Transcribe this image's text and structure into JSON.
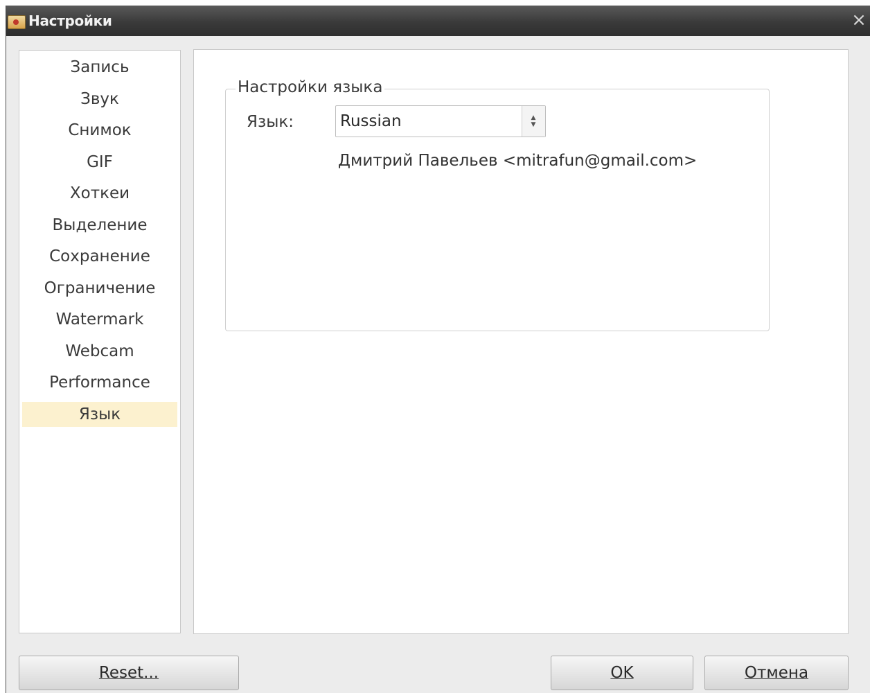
{
  "window": {
    "title": "Настройки",
    "close_glyph": "×"
  },
  "sidebar": {
    "items": [
      {
        "label": "Запись"
      },
      {
        "label": "Звук"
      },
      {
        "label": "Снимок"
      },
      {
        "label": "GIF"
      },
      {
        "label": "Хоткеи"
      },
      {
        "label": "Выделение"
      },
      {
        "label": "Сохранение"
      },
      {
        "label": "Ограничение"
      },
      {
        "label": "Watermark"
      },
      {
        "label": "Webcam"
      },
      {
        "label": "Performance"
      },
      {
        "label": "Язык",
        "selected": true
      }
    ]
  },
  "language_settings": {
    "group_title": "Настройки языка",
    "language_label": "Язык:",
    "language_value": "Russian",
    "translator_credit": "Дмитрий Павельев <mitrafun@gmail.com>"
  },
  "buttons": {
    "reset": "Reset...",
    "ok": "OK",
    "cancel": "Отмена"
  },
  "colors": {
    "selected_item_bg": "#fcf1cf",
    "titlebar": "#3a3a3a"
  },
  "icons": {
    "app": "app-icon",
    "close": "close-icon",
    "combo_arrows": "updown-arrows-icon"
  }
}
